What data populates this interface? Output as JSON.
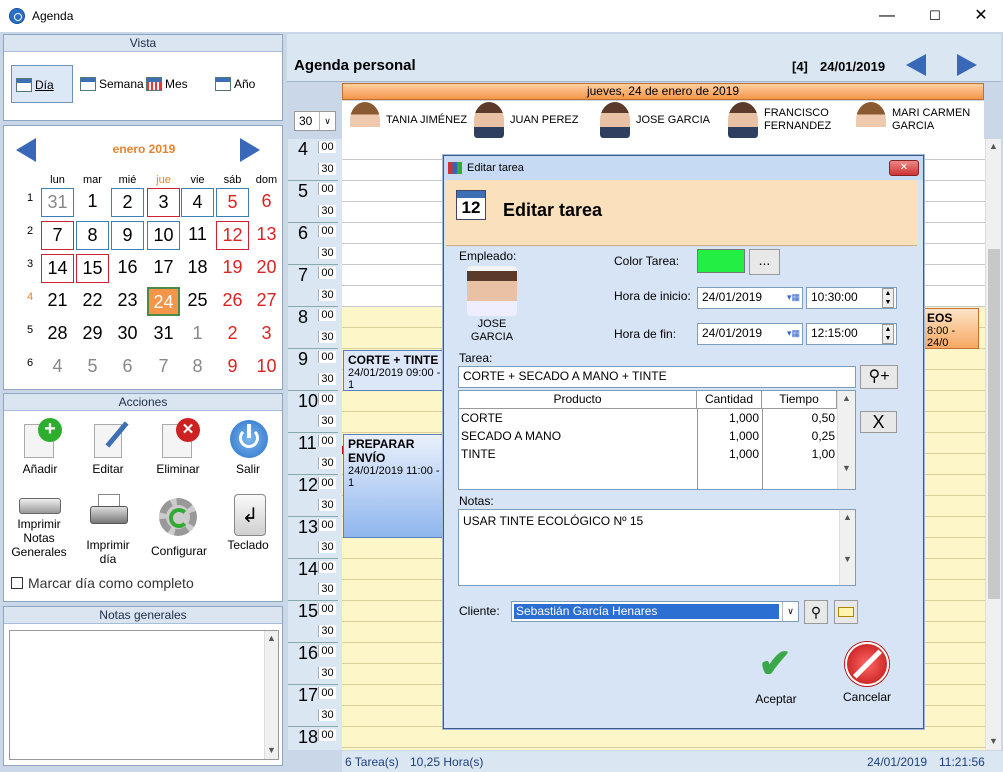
{
  "window": {
    "title": "Agenda",
    "minimize": "—",
    "maximize": "☐",
    "close": "✕"
  },
  "vista": {
    "title": "Vista",
    "dia": "Día",
    "semana": "Semana",
    "mes": "Mes",
    "anio": "Año"
  },
  "calendar": {
    "month": "enero 2019",
    "days_of_week": [
      "lun",
      "mar",
      "mié",
      "jue",
      "vie",
      "sáb",
      "dom"
    ],
    "week_numbers": [
      "1",
      "2",
      "3",
      "4",
      "5",
      "6"
    ],
    "weeks": [
      [
        "31",
        "1",
        "2",
        "3",
        "4",
        "5",
        "6"
      ],
      [
        "7",
        "8",
        "9",
        "10",
        "11",
        "12",
        "13"
      ],
      [
        "14",
        "15",
        "16",
        "17",
        "18",
        "19",
        "20"
      ],
      [
        "21",
        "22",
        "23",
        "24",
        "25",
        "26",
        "27"
      ],
      [
        "28",
        "29",
        "30",
        "31",
        "1",
        "2",
        "3"
      ],
      [
        "4",
        "5",
        "6",
        "7",
        "8",
        "9",
        "10"
      ]
    ]
  },
  "acciones": {
    "title": "Acciones",
    "anadir": "Añadir",
    "editar": "Editar",
    "eliminar": "Eliminar",
    "salir": "Salir",
    "imprimir_notas": "Imprimir Notas Generales",
    "imprimir_dia": "Imprimir día",
    "configurar": "Configurar",
    "teclado": "Teclado",
    "marcar": "Marcar día como completo"
  },
  "notas_generales": {
    "title": "Notas generales"
  },
  "agenda": {
    "title": "Agenda personal",
    "count": "[4]",
    "date": "24/01/2019",
    "date_long": "jueves, 24 de enero de 2019",
    "interval": "30",
    "employees": [
      {
        "name1": "TANIA JIMÉNEZ",
        "name2": ""
      },
      {
        "name1": "JUAN PEREZ",
        "name2": ""
      },
      {
        "name1": "JOSE GARCIA",
        "name2": ""
      },
      {
        "name1": "FRANCISCO",
        "name2": "FERNANDEZ"
      },
      {
        "name1": "MARI CARMEN",
        "name2": "GARCIA"
      }
    ],
    "hours": [
      "4",
      "5",
      "6",
      "7",
      "8",
      "9",
      "10",
      "11",
      "12",
      "13",
      "14",
      "15",
      "16",
      "17",
      "18"
    ],
    "min00": "00",
    "min30": "30",
    "appointments": [
      {
        "title": "CORTE + TINTE",
        "time": "24/01/2019 09:00 - 1"
      },
      {
        "title": "PREPARAR ENVÍO",
        "time": "24/01/2019 11:00 - 1"
      },
      {
        "title": "EOS",
        "time": "8:00 - 24/0"
      }
    ],
    "status_tasks": "6 Tarea(s)",
    "status_hours": "10,25 Hora(s)",
    "status_datetime": "24/01/2019",
    "status_time": "11:21:56"
  },
  "dialog": {
    "window_title": "Editar tarea",
    "heading": "Editar tarea",
    "empleado_label": "Empleado:",
    "empleado_name1": "JOSE",
    "empleado_name2": "GARCIA",
    "color_label": "Color Tarea:",
    "color_value": "#22ee44",
    "color_btn": "...",
    "inicio_label": "Hora de inicio:",
    "inicio_date": "24/01/2019",
    "inicio_time": "10:30:00",
    "fin_label": "Hora de fin:",
    "fin_date": "24/01/2019",
    "fin_time": "12:15:00",
    "tarea_label": "Tarea:",
    "tarea_value": "CORTE + SECADO A MANO + TINTE",
    "table_headers": [
      "Producto",
      "Cantidad",
      "Tiempo"
    ],
    "table_rows": [
      {
        "producto": "CORTE",
        "cantidad": "1,000",
        "tiempo": "0,50"
      },
      {
        "producto": "SECADO A MANO",
        "cantidad": "1,000",
        "tiempo": "0,25"
      },
      {
        "producto": "TINTE",
        "cantidad": "1,000",
        "tiempo": "1,00"
      }
    ],
    "delete_btn": "X",
    "notas_label": "Notas:",
    "notas_value": "USAR TINTE ECOLÓGICO Nº 15",
    "cliente_label": "Cliente:",
    "cliente_value": "Sebastián García Henares",
    "aceptar": "Aceptar",
    "cancelar": "Cancelar"
  }
}
